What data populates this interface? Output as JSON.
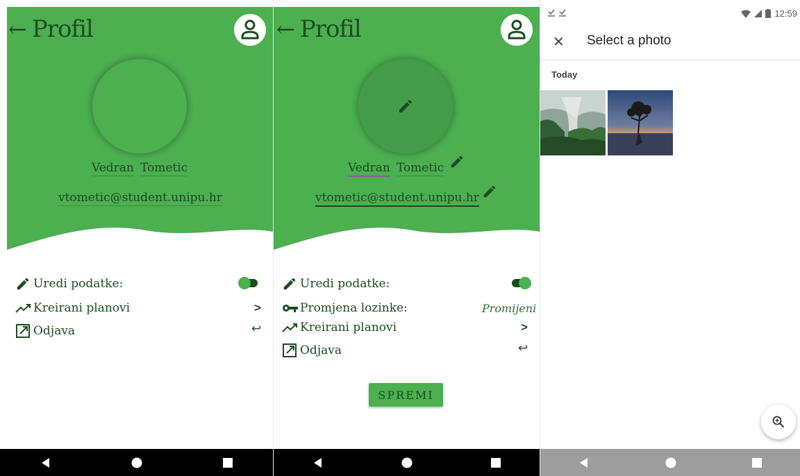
{
  "profile_view": {
    "title": "Profil",
    "first_name": "Vedran",
    "last_name": "Tometic",
    "email": "vtometic@student.unipu.hr",
    "menu": [
      {
        "label": "Uredi podatke:",
        "icon": "pencil-icon",
        "right": "toggle-off"
      },
      {
        "label": "Kreirani planovi",
        "icon": "trending-up-icon",
        "right": ">"
      },
      {
        "label": "Odjava",
        "icon": "external-link-icon",
        "right": "↩"
      }
    ],
    "edit_toggle_on": false
  },
  "profile_edit": {
    "title": "Profil",
    "first_name": "Vedran",
    "last_name": "Tometic",
    "email": "vtometic@student.unipu.hr",
    "menu": [
      {
        "label": "Uredi podatke:",
        "icon": "pencil-icon",
        "right": "toggle-on"
      },
      {
        "label": "Promjena lozinke:",
        "icon": "key-icon",
        "right": "Promijeni"
      },
      {
        "label": "Kreirani planovi",
        "icon": "trending-up-icon",
        "right": ">"
      },
      {
        "label": "Odjava",
        "icon": "external-link-icon",
        "right": "↩"
      }
    ],
    "edit_toggle_on": true,
    "save_label": "SPREMI"
  },
  "photo_picker": {
    "status_time": "12:59",
    "title": "Select a photo",
    "section_label": "Today",
    "photos": [
      "misty-forest-photo",
      "lone-tree-sunset-photo"
    ]
  },
  "colors": {
    "brand_green": "#4caf50",
    "dark_green": "#1b4d1f",
    "nav_dark": "#000000",
    "nav_light": "#9e9e9e"
  }
}
